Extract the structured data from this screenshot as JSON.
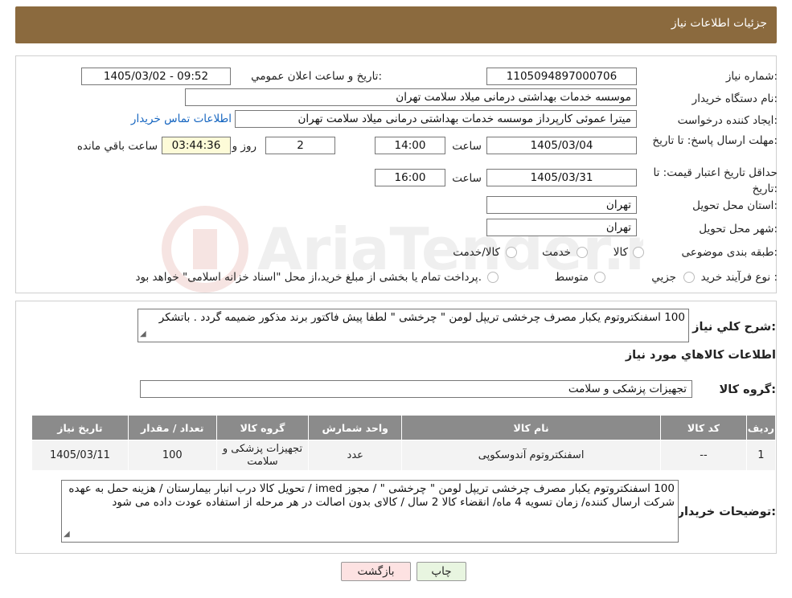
{
  "header": {
    "title": "جزئیات اطلاعات نیاز"
  },
  "fields": {
    "need_number_label": "شماره نیاز:",
    "need_number": "1105094897000706",
    "announce_label": "تاریخ و ساعت اعلان عمومي:",
    "announce_value": "1405/03/02 - 09:52",
    "buyer_org_label": "نام دستگاه خريدار:",
    "buyer_org": "موسسه خدمات بهداشتی درمانی میلاد سلامت تهران",
    "creator_label": "ايجاد کننده درخواست:",
    "creator": "میترا عموئی کارپرداز موسسه خدمات بهداشتی درمانی میلاد سلامت تهران",
    "contact_link": "اطلاعات تماس خريدار",
    "deadline_label": "مهلت ارسال پاسخ: تا تاریخ:",
    "deadline_date": "1405/03/04",
    "time_label": "ساعت",
    "deadline_time": "14:00",
    "days_value": "2",
    "days_label": "روز و",
    "remaining_time": "03:44:36",
    "remaining_label": "ساعت باقي مانده",
    "validity_label": "حداقل تاريخ اعتبار قيمت: تا تاریخ:",
    "validity_date": "1405/03/31",
    "validity_time_label": "ساعت",
    "validity_time": "16:00",
    "province_label": "استان محل تحويل:",
    "province": "تهران",
    "city_label": "شهر محل تحويل:",
    "city": "تهران",
    "category_label": "طبقه بندی موضوعی:",
    "category_options": [
      "کالا",
      "خدمت",
      "کالا/خدمت"
    ],
    "purchase_label": "نوع فرآیند خرید :",
    "purchase_options": [
      "جزیي",
      "متوسط"
    ],
    "purchase_note": "پرداخت تمام یا بخشی از مبلغ خرید،از محل \"اسناد خزانه اسلامی\" خواهد بود."
  },
  "summary": {
    "label": "شرح کلي نياز:",
    "text": "100 اسفنکتروتوم یکبار مصرف چرخشی تریپل لومن \" چرخشی \"  لطفا پیش فاکتور برند مذکور ضمیمه گردد . باتشکر"
  },
  "goods": {
    "section_title": "اطلاعات کالاهاي مورد نياز",
    "group_label": "گروه کالا:",
    "group_value": "تجهیزات پزشکی و سلامت",
    "columns": [
      "رديف",
      "کد کالا",
      "نام کالا",
      "واحد شمارش",
      "گروه کالا",
      "تعداد / مقدار",
      "تاريخ نياز"
    ],
    "rows": [
      [
        "1",
        "--",
        "اسفنکتروتوم آندوسکوپی",
        "عدد",
        "تجهیزات پزشکی و سلامت",
        "100",
        "1405/03/11"
      ]
    ]
  },
  "buyer_notes": {
    "label": "توضيحات خريدار:",
    "text": "100 اسفنکتروتوم یکبار مصرف چرخشی تریپل لومن \" چرخشی \"   / مجوز imed / تحویل کالا درب انبار بیمارستان / هزینه حمل به عهده شرکت ارسال کننده/ زمان تسویه 4 ماه/ انقضاء کالا 2 سال / کالای بدون اصالت در هر مرحله از استفاده عودت داده می شود"
  },
  "buttons": {
    "print": "چاپ",
    "back": "بازگشت"
  },
  "colors": {
    "header": "#8b6a3e",
    "table_header": "#8b8b8b",
    "link": "#1565c0",
    "back_button": "#fde2e2"
  }
}
